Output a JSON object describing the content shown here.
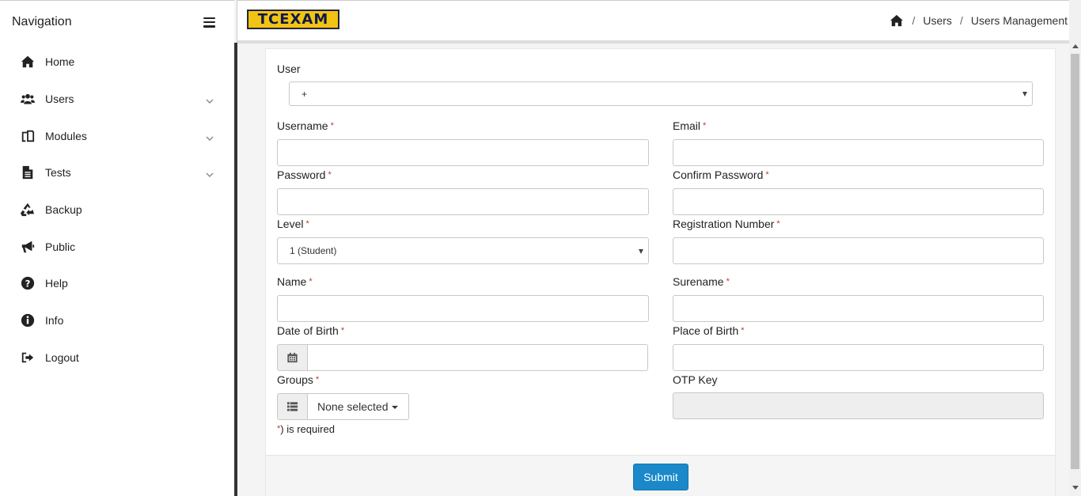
{
  "sidebar": {
    "title": "Navigation",
    "items": [
      {
        "label": "Home",
        "icon": "home-icon",
        "expandable": false
      },
      {
        "label": "Users",
        "icon": "users-icon",
        "expandable": true
      },
      {
        "label": "Modules",
        "icon": "modules-icon",
        "expandable": true
      },
      {
        "label": "Tests",
        "icon": "file-text-icon",
        "expandable": true
      },
      {
        "label": "Backup",
        "icon": "recycle-icon",
        "expandable": false
      },
      {
        "label": "Public",
        "icon": "bullhorn-icon",
        "expandable": false
      },
      {
        "label": "Help",
        "icon": "question-circle-icon",
        "expandable": false
      },
      {
        "label": "Info",
        "icon": "info-circle-icon",
        "expandable": false
      },
      {
        "label": "Logout",
        "icon": "sign-out-icon",
        "expandable": false
      }
    ]
  },
  "header": {
    "logo_text": "TCEXAM",
    "breadcrumb": [
      "Users",
      "Users Management"
    ],
    "separator": "/"
  },
  "form": {
    "user": {
      "label": "User",
      "value": "+"
    },
    "username": {
      "label": "Username",
      "value": ""
    },
    "email": {
      "label": "Email",
      "value": ""
    },
    "password": {
      "label": "Password",
      "value": ""
    },
    "confirm_password": {
      "label": "Confirm Password",
      "value": ""
    },
    "level": {
      "label": "Level",
      "value": "1 (Student)"
    },
    "registration_number": {
      "label": "Registration Number",
      "value": ""
    },
    "name": {
      "label": "Name",
      "value": ""
    },
    "surename": {
      "label": "Surename",
      "value": ""
    },
    "date_of_birth": {
      "label": "Date of Birth",
      "value": ""
    },
    "place_of_birth": {
      "label": "Place of Birth",
      "value": ""
    },
    "groups": {
      "label": "Groups",
      "value": "None selected"
    },
    "otp_key": {
      "label": "OTP Key",
      "value": ""
    },
    "required_marker": "*",
    "required_note": ") is required",
    "submit_label": "Submit"
  },
  "colors": {
    "accent": "#1a88c9",
    "required": "#c0392b",
    "logo_yellow": "#f3c313",
    "logo_navy": "#0e1a4a"
  }
}
